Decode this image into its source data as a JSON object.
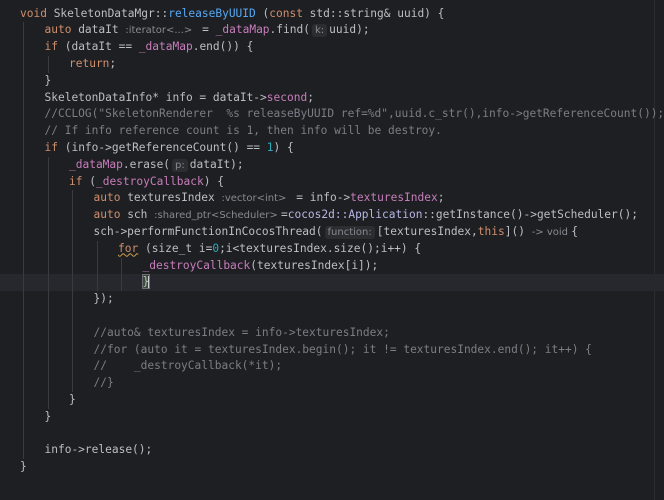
{
  "editor": {
    "lines": [
      {
        "t": [
          [
            "kw",
            "void "
          ],
          [
            "tp",
            "SkeletonDataMgr::"
          ],
          [
            "fn",
            "releaseByUUID"
          ],
          [
            "tp",
            " ("
          ],
          [
            "kw",
            "const "
          ],
          [
            "tp",
            "std::string& uuid) {"
          ]
        ]
      },
      {
        "t": [
          [
            "kw",
            "auto "
          ],
          [
            "tp",
            "dataIt "
          ],
          [
            "typehint",
            ":iterator<...> "
          ],
          [
            "tp",
            " = "
          ],
          [
            "mem",
            "_dataMap"
          ],
          [
            "tp",
            "."
          ],
          [
            "tp",
            "find("
          ],
          [
            "hint",
            "k:"
          ],
          [
            "tp",
            "uuid);"
          ]
        ]
      },
      {
        "t": [
          [
            "kw",
            "if "
          ],
          [
            "tp",
            "(dataIt == "
          ],
          [
            "mem",
            "_dataMap"
          ],
          [
            "tp",
            ".end()) {"
          ]
        ]
      },
      {
        "t": [
          [
            "kw",
            "return"
          ],
          [
            "tp",
            ";"
          ]
        ]
      },
      {
        "t": [
          [
            "tp",
            "}"
          ]
        ]
      },
      {
        "t": [
          [
            "tp",
            "SkeletonDataInfo* info = dataIt->"
          ],
          [
            "mem",
            "second"
          ],
          [
            "tp",
            ";"
          ]
        ]
      },
      {
        "t": [
          [
            "cm",
            "//CCLOG(\"SkeletonRenderer  %s releaseByUUID ref=%d\",uuid.c_str(),info->getReferenceCount());"
          ]
        ]
      },
      {
        "t": [
          [
            "cm",
            "// If info reference count is 1, then info will be destroy."
          ]
        ]
      },
      {
        "t": [
          [
            "kw",
            "if "
          ],
          [
            "tp",
            "(info->getReferenceCount() == "
          ],
          [
            "num",
            "1"
          ],
          [
            "tp",
            ") {"
          ]
        ]
      },
      {
        "t": [
          [
            "mem",
            "_dataMap"
          ],
          [
            "tp",
            ".erase("
          ],
          [
            "hint",
            "p:"
          ],
          [
            "tp",
            "dataIt);"
          ]
        ]
      },
      {
        "t": [
          [
            "kw",
            "if "
          ],
          [
            "tp",
            "("
          ],
          [
            "mem",
            "_destroyCallback"
          ],
          [
            "tp",
            ") {"
          ]
        ]
      },
      {
        "t": [
          [
            "kw",
            "auto "
          ],
          [
            "tp",
            "texturesIndex "
          ],
          [
            "typehint",
            ":vector<int> "
          ],
          [
            "tp",
            " = info->"
          ],
          [
            "mem",
            "texturesIndex"
          ],
          [
            "tp",
            ";"
          ]
        ]
      },
      {
        "t": [
          [
            "kw",
            "auto "
          ],
          [
            "tp",
            "sch "
          ],
          [
            "typehint",
            ":shared_ptr<Scheduler> "
          ],
          [
            "tp",
            "="
          ],
          [
            "ns",
            "cocos2d::Application"
          ],
          [
            "tp",
            "::getInstance()->getScheduler();"
          ]
        ]
      },
      {
        "t": [
          [
            "tp",
            "sch->performFunctionInCocosThread("
          ],
          [
            "hint",
            "function:"
          ],
          [
            "tp",
            "[texturesIndex,"
          ],
          [
            "kw",
            "this"
          ],
          [
            "tp",
            "]() "
          ],
          [
            "typehint",
            "-> void "
          ],
          [
            "tp",
            "{"
          ]
        ]
      },
      {
        "t": [
          [
            "kwsq",
            "for"
          ],
          [
            "tp",
            " (size_t i="
          ],
          [
            "num",
            "0"
          ],
          [
            "tp",
            ";i<texturesIndex.size();i++) {"
          ]
        ]
      },
      {
        "t": [
          [
            "mem",
            "_destroyCallback"
          ],
          [
            "tp",
            "(texturesIndex[i]);"
          ]
        ]
      },
      {
        "t": [
          [
            "bh",
            "}"
          ],
          [
            "caret",
            ""
          ]
        ]
      },
      {
        "t": [
          [
            "tp",
            "});"
          ]
        ]
      },
      {
        "t": []
      },
      {
        "t": [
          [
            "cm",
            "//auto& texturesIndex = info->texturesIndex;"
          ]
        ]
      },
      {
        "t": [
          [
            "cm",
            "//for (auto it = texturesIndex.begin(); it != texturesIndex.end(); it++) {"
          ]
        ]
      },
      {
        "t": [
          [
            "cm",
            "//    _destroyCallback(*it);"
          ]
        ]
      },
      {
        "t": [
          [
            "cm",
            "//}"
          ]
        ]
      },
      {
        "t": [
          [
            "tp",
            "}"
          ]
        ]
      },
      {
        "t": [
          [
            "tp",
            "}"
          ]
        ]
      },
      {
        "t": []
      },
      {
        "t": [
          [
            "tp",
            "info->release();"
          ]
        ]
      },
      {
        "t": [
          [
            "tp",
            "}"
          ]
        ]
      }
    ]
  }
}
